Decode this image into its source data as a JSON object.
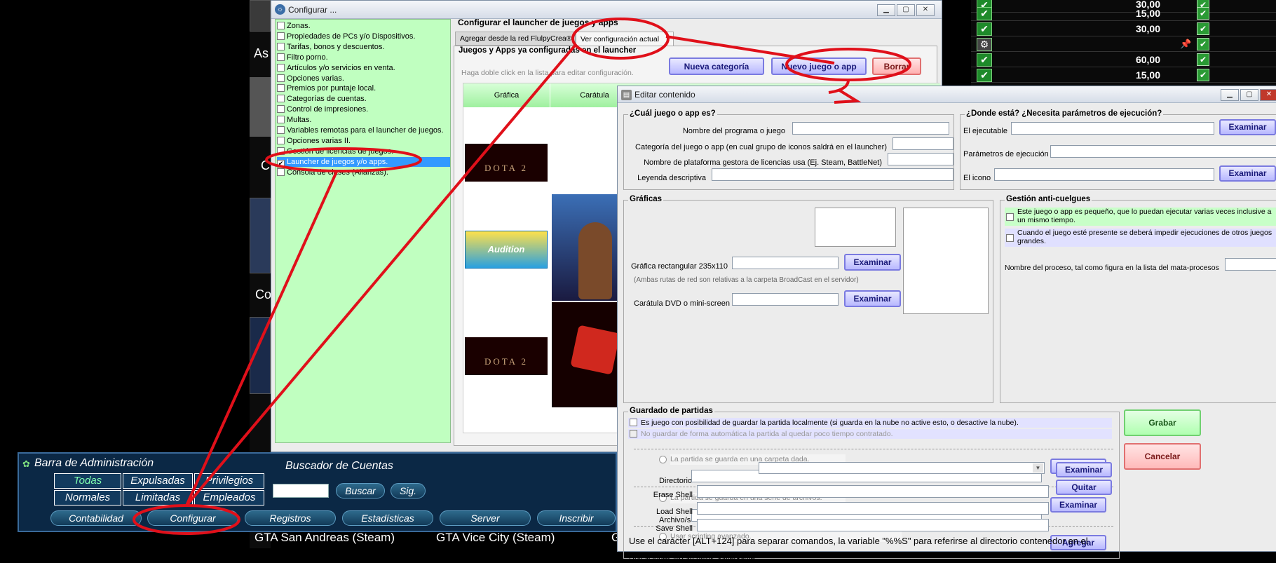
{
  "background": {
    "left_text_1": "As",
    "left_text_2": "C",
    "left_text_3": "Co",
    "right_values": [
      "30,00",
      "15,00",
      "30,00",
      "",
      "60,00",
      "15,00"
    ],
    "bottom_games": [
      "GTA San Andreas (Steam)",
      "GTA Vice City (Steam)",
      "G"
    ]
  },
  "admin_bar": {
    "title": "Barra de Administración",
    "filters": [
      "Todas",
      "Expulsadas",
      "Privilegios",
      "Normales",
      "Limitadas",
      "Empleados"
    ],
    "search_title": "Buscador de Cuentas",
    "search_button": "Buscar",
    "next_button": "Sig.",
    "bottom_buttons": [
      "Contabilidad",
      "Configurar",
      "Registros",
      "Estadísticas",
      "Server",
      "Inscribir"
    ]
  },
  "config_window": {
    "title": "Configurar ...",
    "nav_items": [
      {
        "label": "Zonas.",
        "checked": false
      },
      {
        "label": "Propiedades de PCs y/o Dispositivos.",
        "checked": false
      },
      {
        "label": "Tarifas, bonos y descuentos.",
        "checked": false
      },
      {
        "label": "Filtro porno.",
        "checked": false
      },
      {
        "label": "Artículos y/o servicios en venta.",
        "checked": false
      },
      {
        "label": "Opciones varias.",
        "checked": false
      },
      {
        "label": "Premios por puntaje local.",
        "checked": false
      },
      {
        "label": "Categorías de cuentas.",
        "checked": false
      },
      {
        "label": "Control de impresiones.",
        "checked": false
      },
      {
        "label": "Multas.",
        "checked": false
      },
      {
        "label": "Variables remotas para el launcher de juegos.",
        "checked": false
      },
      {
        "label": "Opciones varias II.",
        "checked": false
      },
      {
        "label": "Gestión de licencias de juegos.",
        "checked": false
      },
      {
        "label": "Launcher de juegos y/o apps.",
        "checked": true
      },
      {
        "label": "Consola de clases (Alianzas).",
        "checked": false
      }
    ],
    "panel_title": "Configurar el launcher de juegos y apps",
    "tabs": [
      "Agregar desde la red FlulpyCrea®",
      "Ver configuración actual"
    ],
    "section_title": "Juegos y Apps ya configuradas en el launcher",
    "hint": "Haga doble click en la lista para editar configuración.",
    "buttons": {
      "new_category": "Nueva categoría",
      "new_game": "Nuevo juego o app",
      "delete": "Borrar"
    },
    "grid_headers": [
      "Gráfica",
      "Carátula"
    ],
    "rows": [
      {
        "graphic": "DOTA 2",
        "cover": ""
      },
      {
        "graphic": "Audition",
        "cover": ""
      },
      {
        "graphic": "DOTA 2",
        "cover": ""
      }
    ]
  },
  "edit_window": {
    "title": "Editar contenido",
    "which_title": "¿Cuál juego o app es?",
    "which_fields": [
      {
        "label": "Nombre del programa o juego",
        "value": ""
      },
      {
        "label": "Categoría del juego o app (en cual grupo de iconos saldrá en el launcher)",
        "value": ""
      },
      {
        "label": "Nombre de plataforma gestora de licencias usa (Ej. Steam, BattleNet)",
        "value": ""
      },
      {
        "label": "Leyenda descriptiva",
        "value": ""
      }
    ],
    "where_title": "¿Donde está? ¿Necesita parámetros de ejecución?",
    "where_fields": [
      {
        "label": "El ejecutable",
        "value": ""
      },
      {
        "label": "Parámetros de ejecución",
        "value": ""
      },
      {
        "label": "El icono",
        "value": ""
      }
    ],
    "browse": "Examinar",
    "graphics_title": "Gráficas",
    "graphic_rect_label": "Gráfica rectangular 235x110",
    "graphics_note": "(Ambas rutas de red son relativas a la carpeta BroadCast en el servidor)",
    "dvd_label": "Carátula DVD o mini-screen",
    "anticrash_title": "Gestión anti-cuelgues",
    "anticrash_opt1": "Este juego o app es pequeño, que lo puedan ejecutar varias veces inclusive a un mismo tiempo.",
    "anticrash_opt2": "Cuando el juego esté presente se deberá impedir ejecuciones de otros juegos grandes.",
    "process_label": "Nombre del proceso, tal como figura en la lista del mata-procesos",
    "save_title": "Guardado de partidas",
    "save_opt1": "Es juego con posibilidad de guardar la partida localmente (si guarda en la nube no active esto, o desactive la nube).",
    "save_opt2": "No guardar de forma automática la partida al quedar poco tiempo contratado.",
    "radio1": "La partida se guarda en una carpeta dada.",
    "dir_label": "Directorio",
    "radio2": "La partida se guarda en una serie de archivos.",
    "files_label": "Archivo/s",
    "radio3": "Usar scripting avanzado.",
    "locations_label": "Ubicaciones y/o archivos SaveGame",
    "add": "Agregar",
    "remove": "Quitar",
    "erase_shell": "Erase Shell",
    "load_shell": "Load Shell",
    "save_shell": "Save Shell",
    "footer_note": "Use el carácter [ALT+124] para separar comandos, la variable \"%%S\" para referirse al directorio contenedor en el",
    "save_button": "Grabar",
    "cancel_button": "Cancelar"
  },
  "colors": {
    "annotation": "#e0101a",
    "nav_bg": "#c0ffc0",
    "selection": "#3399ff"
  }
}
